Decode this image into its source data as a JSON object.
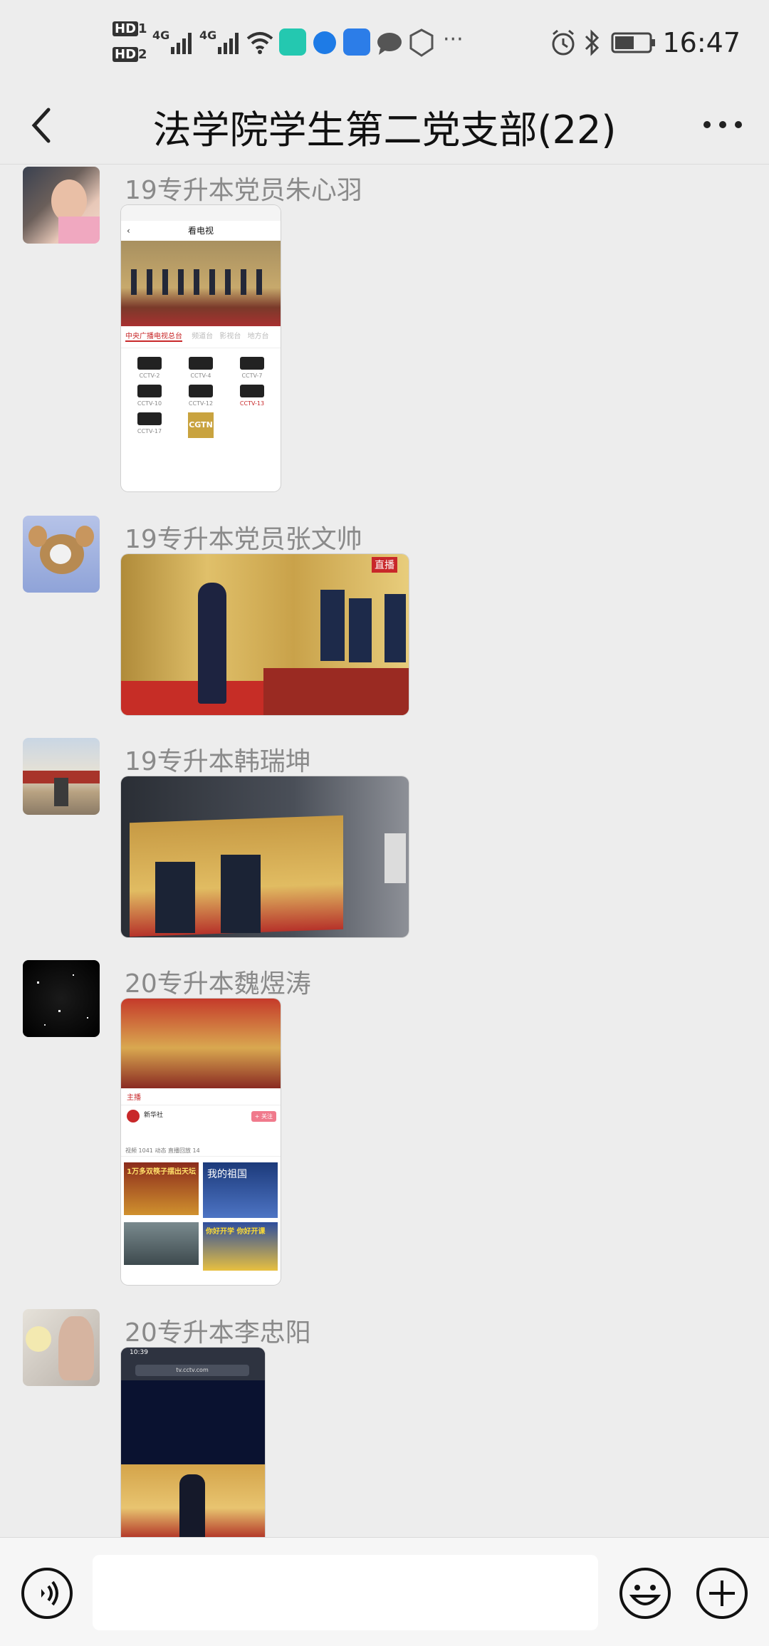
{
  "status_bar": {
    "hd1": "HD",
    "hd1_sub": "1",
    "hd2": "HD",
    "hd2_sub": "2",
    "net1": "4G",
    "net2": "4G",
    "time": "16:47",
    "more_dots": "···"
  },
  "header": {
    "title": "法学院学生第二党支部(22)"
  },
  "messages": [
    {
      "sender": "19专升本党员朱心羽"
    },
    {
      "sender": "19专升本党员张文帅"
    },
    {
      "sender": "19专升本韩瑞坤"
    },
    {
      "sender": "20专升本魏煜涛"
    },
    {
      "sender": "20专升本李忠阳"
    }
  ],
  "screenshot1": {
    "title": "看电视",
    "tab_active": "中央广播电视总台",
    "tabs_other": [
      "频道台",
      "影视台",
      "地方台"
    ],
    "channels": [
      "CCTV-2",
      "CCTV-4",
      "CCTV-7",
      "CCTV-10",
      "CCTV-12",
      "CCTV-13",
      "CCTV-17",
      "CGTN"
    ]
  },
  "screenshot2": {
    "badge": "直播"
  },
  "screenshot4": {
    "tab": "主播",
    "name": "新华社",
    "follow": "+ 关注",
    "tabs_row": "视频 1041   动态   直播回放 14",
    "card1": "1万多双筷子摆出天坛",
    "card2": "我的祖国",
    "card4": "你好开学 你好开课"
  },
  "screenshot5": {
    "time": "10:39",
    "url": "tv.cctv.com"
  },
  "colors": {
    "bg": "#ededed",
    "red": "#c8282a",
    "gold": "#c9a33f"
  }
}
